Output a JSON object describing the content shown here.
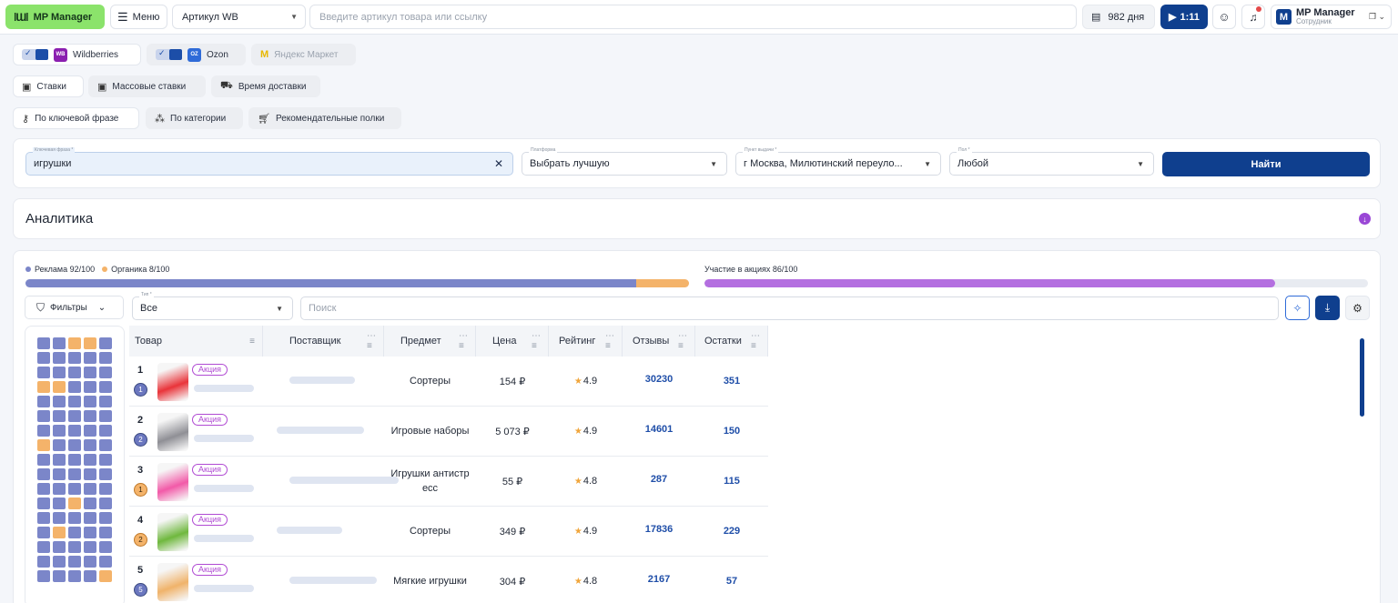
{
  "header": {
    "logo": "MP Manager",
    "menu_label": "Меню",
    "search_type": "Артикул WB",
    "search_placeholder": "Введите артикул товара или ссылку",
    "days": "982 дня",
    "timer": "1:11",
    "account_name": "MP Manager",
    "account_role": "Сотрудник",
    "avatar_letter": "M"
  },
  "marketplaces": [
    {
      "label": "Wildberries",
      "logo": "WB",
      "color": "#8b1fb0",
      "enabled": true
    },
    {
      "label": "Ozon",
      "logo": "OZON",
      "color": "#2f6bd8",
      "enabled": true
    },
    {
      "label": "Яндекс Маркет",
      "color": "#f5c400",
      "enabled": false
    }
  ],
  "bid_tabs": [
    "Ставки",
    "Массовые ставки",
    "Время доставки"
  ],
  "search_modes": [
    "По ключевой фразе",
    "По категории",
    "Рекомендательные полки"
  ],
  "form": {
    "keyword_label": "Ключевая фраза *",
    "keyword_value": "игрушки",
    "platform_label": "Платформа",
    "platform_value": "Выбрать лучшую",
    "pickup_label": "Пункт выдачи *",
    "pickup_value": "г Москва, Милютинский переуло...",
    "gender_label": "Пол *",
    "gender_value": "Любой",
    "find_label": "Найти"
  },
  "analytics_title": "Аналитика",
  "stats": {
    "ads_label": "Реклама 92/100",
    "organic_label": "Органика 8/100",
    "ads_value": 92,
    "organic_value": 8,
    "promo_label": "Участие в акциях 86/100",
    "promo_value": 86,
    "colors": {
      "ads": "#7b86c9",
      "organic": "#f4b36a",
      "promo": "#b46fe0"
    }
  },
  "toolbar": {
    "filters_label": "Фильтры",
    "type_label": "Тип *",
    "type_value": "Все",
    "search_placeholder": "Поиск"
  },
  "heatmap": [
    "a",
    "a",
    "o",
    "o",
    "a",
    "a",
    "a",
    "a",
    "a",
    "a",
    "a",
    "a",
    "a",
    "a",
    "a",
    "o",
    "o",
    "a",
    "a",
    "a",
    "a",
    "a",
    "a",
    "a",
    "a",
    "a",
    "a",
    "a",
    "a",
    "a",
    "a",
    "a",
    "a",
    "a",
    "a",
    "o",
    "a",
    "a",
    "a",
    "a",
    "a",
    "a",
    "a",
    "a",
    "a",
    "a",
    "a",
    "a",
    "a",
    "a",
    "a",
    "a",
    "a",
    "a",
    "a",
    "a",
    "a",
    "o",
    "a",
    "a",
    "a",
    "a",
    "a",
    "a",
    "a",
    "a",
    "o",
    "a",
    "a",
    "a",
    "a",
    "a",
    "a",
    "a",
    "a",
    "a",
    "a",
    "a",
    "a",
    "a",
    "a",
    "a",
    "a",
    "a",
    "o"
  ],
  "table": {
    "columns": [
      "Товар",
      "Поставщик",
      "Предмет",
      "Цена",
      "Рейтинг",
      "Отзывы",
      "Остатки"
    ],
    "promo_badge": "Акция",
    "rows": [
      {
        "rank": "1",
        "position": "1",
        "pos_type": "ad",
        "subject": "Сортеры",
        "price": "154 ₽",
        "rating": "4.9",
        "reviews": "30230",
        "stock": "351",
        "thumb": "#e9343a"
      },
      {
        "rank": "2",
        "position": "2",
        "pos_type": "ad",
        "subject": "Игровые наборы",
        "price": "5 073 ₽",
        "rating": "4.9",
        "reviews": "14601",
        "stock": "150",
        "thumb": "#8f8f95"
      },
      {
        "rank": "3",
        "position": "1",
        "pos_type": "organic",
        "subject": "Игрушки антистр есс",
        "price": "55 ₽",
        "rating": "4.8",
        "reviews": "287",
        "stock": "115",
        "thumb": "#f25aa8"
      },
      {
        "rank": "4",
        "position": "2",
        "pos_type": "organic",
        "subject": "Сортеры",
        "price": "349 ₽",
        "rating": "4.9",
        "reviews": "17836",
        "stock": "229",
        "thumb": "#6fb83e"
      },
      {
        "rank": "5",
        "position": "5",
        "pos_type": "ad",
        "subject": "Мягкие игрушки",
        "price": "304 ₽",
        "rating": "4.8",
        "reviews": "2167",
        "stock": "57",
        "thumb": "#f0b36a"
      }
    ]
  }
}
